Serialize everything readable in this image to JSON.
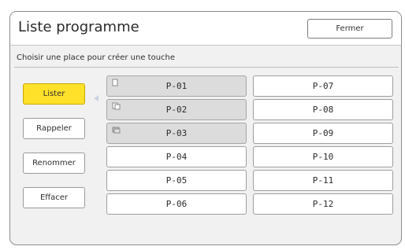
{
  "window": {
    "title": "Liste programme",
    "close_label": "Fermer"
  },
  "instruction": "Choisir une place pour créer une touche",
  "actions": [
    {
      "label": "Lister",
      "active": true
    },
    {
      "label": "Rappeler",
      "active": false
    },
    {
      "label": "Renommer",
      "active": false
    },
    {
      "label": "Effacer",
      "active": false
    }
  ],
  "slots": {
    "left": [
      {
        "label": "P-01",
        "used": true
      },
      {
        "label": "P-02",
        "used": true
      },
      {
        "label": "P-03",
        "used": true
      },
      {
        "label": "P-04",
        "used": false
      },
      {
        "label": "P-05",
        "used": false
      },
      {
        "label": "P-06",
        "used": false
      }
    ],
    "right": [
      {
        "label": "P-07",
        "used": false
      },
      {
        "label": "P-08",
        "used": false
      },
      {
        "label": "P-09",
        "used": false
      },
      {
        "label": "P-10",
        "used": false
      },
      {
        "label": "P-11",
        "used": false
      },
      {
        "label": "P-12",
        "used": false
      }
    ]
  },
  "colors": {
    "active_button": "#ffe12a",
    "used_slot": "#dcdcdc",
    "panel_background": "#f1f1f1",
    "pointer_arrow": "#c8d3e2"
  },
  "icons": {
    "used_slot_icon": "document-icon",
    "selection_pointer": "pointer-arrow-icon"
  }
}
